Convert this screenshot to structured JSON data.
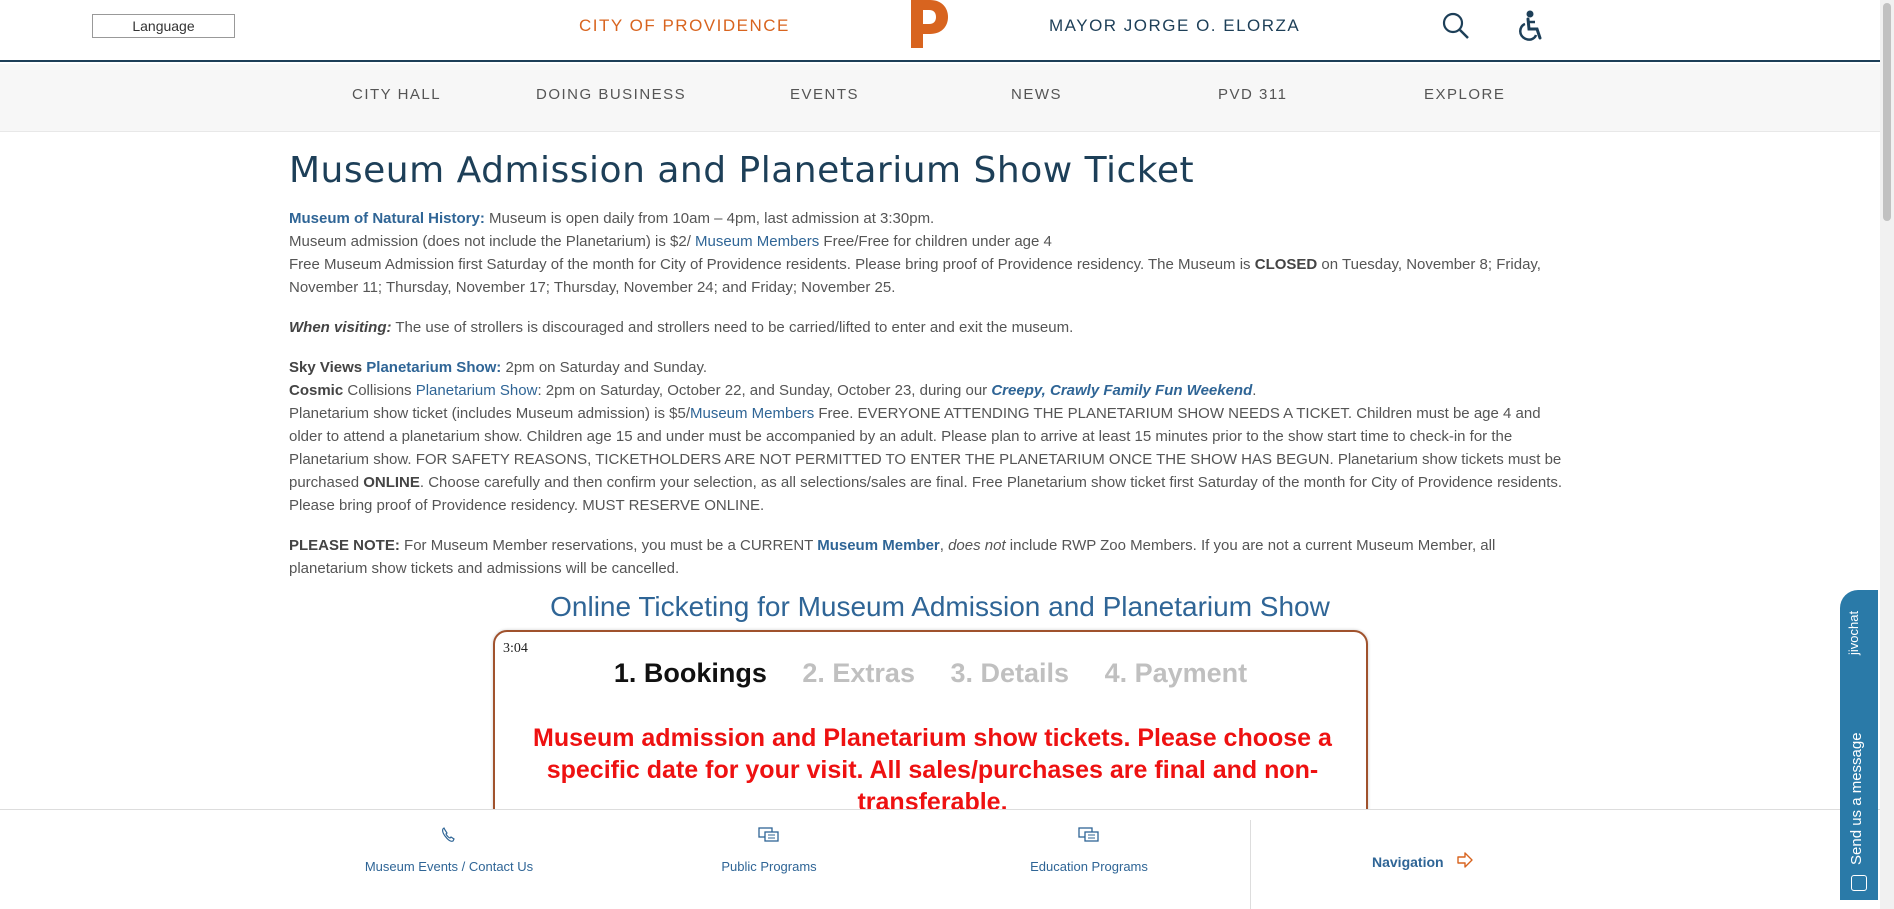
{
  "header": {
    "language_label": "Language",
    "city": "CITY OF PROVIDENCE",
    "mayor": "MAYOR JORGE O. ELORZA",
    "logo_letter": "P",
    "brand_color": "#d8641f",
    "icons": {
      "search": "search-icon",
      "accessibility": "accessibility-icon"
    }
  },
  "nav": [
    "CITY HALL",
    "DOING BUSINESS",
    "EVENTS",
    "NEWS",
    "PVD 311",
    "EXPLORE"
  ],
  "page": {
    "title": "Museum Admission and Planetarium Show Ticket",
    "museum_label": "Museum of Natural History:",
    "museum_hours": " Museum is open daily from 10am – 4pm, last admission at 3:30pm.",
    "admission_prefix": "Museum admission (does not include the Planetarium) is $2/ ",
    "members_link": "Museum Members",
    "admission_suffix": " Free/Free for children under age 4",
    "free_admission_prefix": "Free Museum Admission first Saturday of the month for City of Providence residents. Please bring proof of Providence residency. The Museum is ",
    "closed_word": "CLOSED",
    "free_admission_suffix": " on Tuesday, November 8; Friday, November 11; Thursday, November 17; Thursday, November 24; and Friday; November 25.",
    "visiting_label": "When visiting:",
    "visiting_text": " The use of strollers is discouraged and strollers need to be carried/lifted to enter and exit the museum.",
    "skyviews_label": "Sky Views ",
    "planetarium_show_link": "Planetarium Show:",
    "skyviews_text": " 2pm on Saturday and Sunday.",
    "cosmic_label": "Cosmic",
    "collisions_text": " Collisions ",
    "planetarium_show_link2": "Planetarium Show",
    "cosmic_text": ": 2pm on Saturday, October 22, and Sunday, October 23, during our ",
    "event_link": "Creepy, Crawly Family Fun Weekend",
    "period": ".",
    "ticket_prefix": "Planetarium show ticket (includes Museum admission) is $5/",
    "members_link2": "Museum Members",
    "ticket_text": " Free. EVERYONE ATTENDING THE PLANETARIUM SHOW NEEDS A TICKET. Children must be age 4 and older to attend a planetarium show. Children age 15 and under must be accompanied by an adult. Please plan to arrive at least 15 minutes prior to the show start time to check-in for the Planetarium show. FOR SAFETY REASONS, TICKETHOLDERS ARE NOT PERMITTED TO ENTER THE PLANETARIUM ONCE THE SHOW HAS BEGUN. Planetarium show tickets must be purchased ",
    "online_word": "ONLINE",
    "ticket_suffix": ". Choose carefully and then confirm your selection, as all selections/sales are final. Free Planetarium show ticket first Saturday of the month for City of Providence residents. Please bring proof of Providence residency. MUST RESERVE ONLINE.",
    "note_label": "PLEASE NOTE:",
    "note_prefix": " For Museum Member reservations, you must be a CURRENT ",
    "member_link": "Museum Member",
    "note_comma": ", ",
    "note_italic": "does not",
    "note_suffix": " include RWP Zoo Members. If you are not a current Museum Member, all planetarium show tickets and admissions will be cancelled."
  },
  "ticketing": {
    "title": "Online Ticketing for Museum Admission and Planetarium Show",
    "timer": "3:04",
    "steps": [
      "1. Bookings",
      "2. Extras",
      "3. Details",
      "4. Payment"
    ],
    "notice": "Museum admission and Planetarium show tickets. Please choose a specific date for your visit. All sales/purchases are final and non-transferable."
  },
  "footer": {
    "items": [
      {
        "label": "Museum Events / Contact Us",
        "icon": "phone-icon"
      },
      {
        "label": "Public Programs",
        "icon": "chat-bubbles-icon"
      },
      {
        "label": "Education Programs",
        "icon": "chat-bubbles-icon"
      }
    ],
    "nav_label": "Navigation",
    "nav_icon": "arrow-right-icon"
  },
  "chat": {
    "brand": "jivochat",
    "message": "Send us a message",
    "color": "#2a7aa8"
  }
}
